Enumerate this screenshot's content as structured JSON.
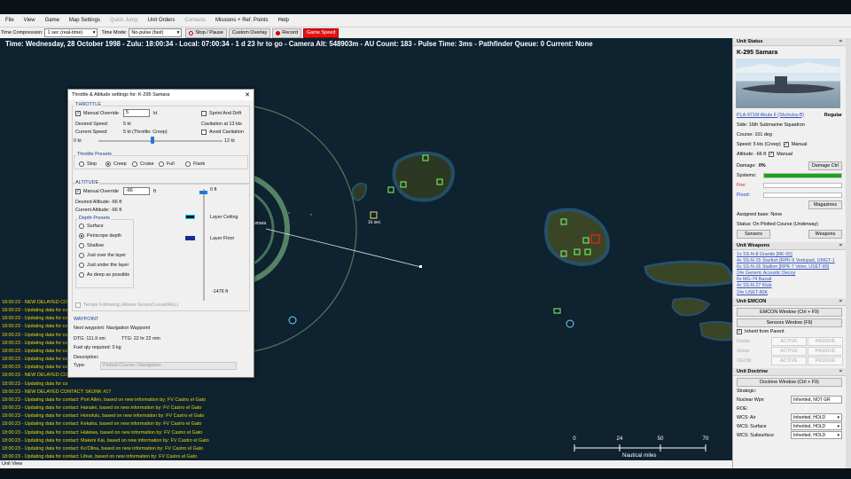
{
  "menu": {
    "items": [
      {
        "label": "File",
        "enabled": true
      },
      {
        "label": "View",
        "enabled": true
      },
      {
        "label": "Game",
        "enabled": true
      },
      {
        "label": "Map Settings",
        "enabled": true
      },
      {
        "label": "Quick Jump",
        "enabled": false
      },
      {
        "label": "Unit Orders",
        "enabled": true
      },
      {
        "label": "Contacts",
        "enabled": false
      },
      {
        "label": "Missions + Ref. Points",
        "enabled": true
      },
      {
        "label": "Help",
        "enabled": true
      }
    ]
  },
  "toolbar": {
    "time_compression_label": "Time Compression:",
    "time_compression_value": "1 sec (real-time)",
    "time_mode_label": "Time Mode:",
    "time_mode_value": "No-pulse (fast)",
    "stop_pause_label": "Stop / Pause",
    "custom_overlay_label": "Custom Overlay",
    "record_label": "Record",
    "red_button_label": "Game Speed"
  },
  "status_line": "Time: Wednesday, 28 October 1998 - Zulu: 18:00:34 - Local: 07:00:34 - 1 d 23 hr to go -  Camera Alt: 548903m - AU Count: 183 - Pulse Time: 3ms - Pathfinder Queue: 0 Current: None",
  "map": {
    "unit_label": "amara",
    "waypoint_label": "1k sec",
    "scale": {
      "ticks": [
        "0",
        "24",
        "50",
        "70"
      ],
      "unit": "Nautical miles"
    }
  },
  "log": [
    "18:00:23 - NEW DELAYED CONTACT",
    "18:00:23 - Updating data for cont",
    "18:00:23 - Updating data for cont",
    "18:00:23 - Updating data for cont",
    "18:00:23 - Updating data for cont",
    "18:00:23 - Updating data for cont",
    "18:00:23 - Updating data for cont",
    "18:00:23 - Updating data for cont",
    "18:00:23 - Updating data for cont",
    "18:00:23 - NEW DELAYED CO",
    "18:00:23 - Updating data for co",
    "18:00:23 - NEW DELAYED CONTACT: SKUNK #17",
    "18:00:23 - Updating data for contact: Port Allen, based on new information by: FV Castro el Gato",
    "18:00:23 - Updating data for contact: Hanalei, based on new information by: FV Castro el Gato",
    "18:00:23 - Updating data for contact: Honolulu, based on new information by: FV Castro el Gato",
    "18:00:23 - Updating data for contact: Kekaha, based on new information by: FV Castro el Gato",
    "18:00:23 - Updating data for contact: Haleiwa, based on new information by: FV Castro el Gato",
    "18:00:23 - Updating data for contact: Makeni Kai, based on new information by: FV Castro el Gato",
    "18:00:23 - Updating data for contact: Ko'Olina, based on new information by: FV Castro el Gato",
    "18:00:23 - Updating data for contact: Lihue, based on new information by: FV Castro el Gato"
  ],
  "bottom_status": "Unit View",
  "dialog": {
    "title": "Throttle & Altitude settings for: K-295 Samara",
    "throttle": {
      "group_title": "THROTTLE",
      "manual_override_label": "Manual Override",
      "manual_override_checked": true,
      "speed_value": "5",
      "speed_unit": "kt",
      "sprint_drift_label": "Sprint And Drift",
      "cavitation_text": "Cavitation at 13 kts",
      "avoid_cavitation_label": "Avoid Cavitation",
      "desired_speed_label": "Desired Speed:",
      "desired_speed_value": "5 kt",
      "current_speed_label": "Current Speed:",
      "current_speed_value": "5 kt (Throttle: Creep)",
      "slider_min": "0 kt",
      "slider_max": "12 kt",
      "slider_fraction": 0.42,
      "presets_title": "Throttle Presets",
      "presets": [
        {
          "label": "Stop",
          "selected": false
        },
        {
          "label": "Creep",
          "selected": true
        },
        {
          "label": "Cruise",
          "selected": false
        },
        {
          "label": "Full",
          "selected": false
        },
        {
          "label": "Flank",
          "selected": false
        }
      ]
    },
    "altitude": {
      "group_title": "ALTITUDE",
      "manual_override_label": "Manual Override",
      "manual_override_checked": true,
      "alt_value": "-66",
      "alt_unit": "ft",
      "desired_label": "Desired Altitude:",
      "desired_value": "-66 ft",
      "current_label": "Current Altitude:",
      "current_value": "-66 ft",
      "depth_presets_title": "Depth Presets",
      "depth_presets": [
        {
          "label": "Surface",
          "selected": false
        },
        {
          "label": "Periscope depth",
          "selected": true
        },
        {
          "label": "Shallow",
          "selected": false
        },
        {
          "label": "Just over the layer",
          "selected": false
        },
        {
          "label": "Just under the layer",
          "selected": false
        },
        {
          "label": "As deep as possible",
          "selected": false
        }
      ],
      "scale_top": "0 ft",
      "scale_bottom": "-1476 ft",
      "layer_ceiling_label": "Layer Ceiling",
      "layer_floor_label": "Layer Floor",
      "terrain_following_label": "Terrain Following (Above Ground Level/AGL)"
    },
    "waypoint": {
      "title": "WAYPOINT",
      "next_label": "Next waypoint: Navigation Waypoint",
      "dtg": "DTG: 111.9 nm",
      "ttg": "TTG: 22 hr 22 min",
      "fuel": "Fuel qty required: 0 kg",
      "description_label": "Description:",
      "type_label": "Type:",
      "type_value": "Plotted Course / Navigation"
    }
  },
  "unit_status": {
    "header": "Unit Status",
    "unit_name": "K-295 Samara",
    "class_link": "PLA-971M Akula II (Shchuka-B)",
    "proficiency": "Regular",
    "side": "Side: 16th Submarine Squadron",
    "course": "Course: 101 deg",
    "speed": "Speed: 5 kts (Creep)",
    "speed_manual": "Manual",
    "altitude": "Altitude: -66 ft",
    "altitude_manual": "Manual",
    "damage_label": "Damage:",
    "damage_value": "0%",
    "damage_ctrl_button": "Damage Ctrl",
    "systems_label": "Systems:",
    "fire_label": "Fire:",
    "flood_label": "Flood:",
    "magazines_button": "Magazines",
    "assigned_base": "Assigned base: None",
    "status_text": "Status: On Plotted Course (Underway)",
    "sensors_button": "Sensors",
    "weapons_button": "Weapons"
  },
  "unit_weapons": {
    "header": "Unit Weapons",
    "items": [
      "1x SS-N-8 Granite [RK-55]",
      "4x SS-N-15 Starfish [RPK-6 Vodopad, UMGT-1",
      "6x SS-N-16 Stallion [RPK-7 Veter, USET-80]",
      "24x Generic Acoustic Decoy",
      "6x MG-74 Bazalt",
      "4x SS-N-27 Klub",
      "24x USET-80K"
    ]
  },
  "unit_emcon": {
    "header": "Unit EMCON",
    "emcon_window_button": "EMCON Window (Ctrl + F9)",
    "sensors_window_button": "Sensors Window (F9)",
    "inherit_label": "Inherit from Parent",
    "rows": [
      {
        "label": "Radar",
        "active": "ACTIVE",
        "passive": "PASSIVE"
      },
      {
        "label": "Sonar",
        "active": "ACTIVE",
        "passive": "PASSIVE"
      },
      {
        "label": "OECM",
        "active": "ACTIVE",
        "passive": "PASSIVE"
      }
    ]
  },
  "unit_doctrine": {
    "header": "Unit Doctrine",
    "doctrine_window_button": "Doctrine Window (Ctrl + F9)",
    "strategic_label": "Strategic:",
    "nuclear_label": "Nuclear Wpn",
    "nuclear_value": "Inherited, NOT GR",
    "roe_label": "ROE:",
    "rows": [
      {
        "label": "WCS: Air",
        "value": "Inherited, HOLD"
      },
      {
        "label": "WCS: Surface",
        "value": "Inherited, HOLD"
      },
      {
        "label": "WCS: Subsurface",
        "value": "Inherited, HOLD"
      }
    ]
  },
  "colors": {
    "map_water": "#0e2230",
    "log_text": "#f0d600",
    "unit_green": "#7cff6b",
    "range_ring": "#8fd68f",
    "accent_blue": "#1e78d7",
    "record_red": "#e01515"
  }
}
